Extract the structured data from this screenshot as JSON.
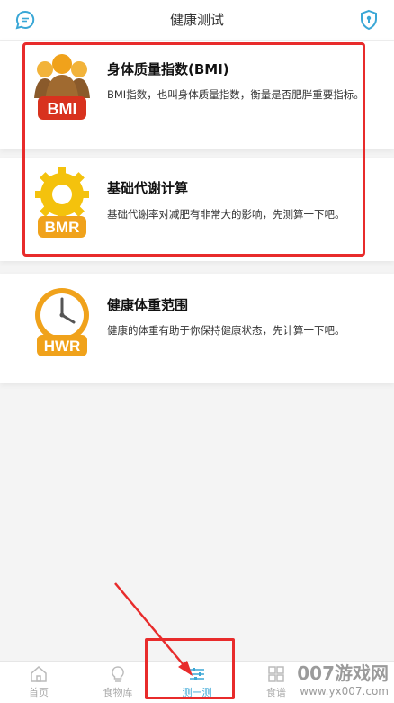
{
  "header": {
    "title": "健康测试",
    "left_icon": "chat-bubble-icon",
    "right_icon": "shield-lock-icon"
  },
  "cards": [
    {
      "logo_text": "BMI",
      "title": "身体质量指数(BMI)",
      "desc": "BMI指数，也叫身体质量指数，衡量是否肥胖重要指标。"
    },
    {
      "logo_text": "BMR",
      "title": "基础代谢计算",
      "desc": "基础代谢率对减肥有非常大的影响，先测算一下吧。"
    },
    {
      "logo_text": "HWR",
      "title": "健康体重范围",
      "desc": "健康的体重有助于你保持健康状态，先计算一下吧。"
    }
  ],
  "tabs": [
    {
      "label": "首页",
      "icon": "home-icon"
    },
    {
      "label": "食物库",
      "icon": "lightbulb-icon"
    },
    {
      "label": "测一测",
      "icon": "sliders-icon",
      "active": true
    },
    {
      "label": "食谱",
      "icon": "grid-icon"
    }
  ],
  "watermark": {
    "line1": "007游戏网",
    "line2": "www.yx007.com"
  },
  "colors": {
    "accent": "#3aa7d6",
    "annotation": "#e82b2b",
    "logo_orange": "#f0a21b"
  }
}
